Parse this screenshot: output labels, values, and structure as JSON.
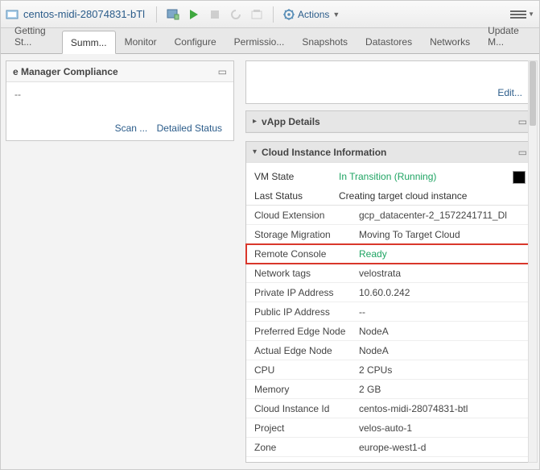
{
  "topbar": {
    "vm_title": "centos-midi-28074831-bTl",
    "actions_label": "Actions"
  },
  "tabs": [
    {
      "label": "Getting St..."
    },
    {
      "label": "Summ..."
    },
    {
      "label": "Monitor"
    },
    {
      "label": "Configure"
    },
    {
      "label": "Permissio..."
    },
    {
      "label": "Snapshots"
    },
    {
      "label": "Datastores"
    },
    {
      "label": "Networks"
    },
    {
      "label": "Update M..."
    }
  ],
  "left_panel": {
    "title": "e Manager Compliance",
    "value": "--",
    "scan_link": "Scan ...",
    "detail_link": "Detailed Status"
  },
  "right_top": {
    "edit_link": "Edit..."
  },
  "vapp_panel": {
    "title": "vApp Details"
  },
  "cloud_panel": {
    "title": "Cloud Instance Information",
    "vm_state_label": "VM State",
    "vm_state_value": "In Transition (Running)",
    "last_status_label": "Last Status",
    "last_status_value": "Creating target cloud instance",
    "rows": [
      {
        "label": "Cloud Extension",
        "value": "gcp_datacenter-2_1572241711_Dl"
      },
      {
        "label": "Storage Migration",
        "value": "Moving To Target Cloud"
      },
      {
        "label": "Remote Console",
        "value": "Ready",
        "green": true,
        "highlight": true
      },
      {
        "label": "Network tags",
        "value": "velostrata"
      },
      {
        "label": "Private IP Address",
        "value": "10.60.0.242"
      },
      {
        "label": "Public IP Address",
        "value": "--"
      },
      {
        "label": "Preferred Edge Node",
        "value": "NodeA"
      },
      {
        "label": "Actual Edge Node",
        "value": "NodeA"
      },
      {
        "label": "CPU",
        "value": "2 CPUs"
      },
      {
        "label": "Memory",
        "value": "2 GB"
      },
      {
        "label": "Cloud Instance Id",
        "value": "centos-midi-28074831-btl"
      },
      {
        "label": "Project",
        "value": "velos-auto-1"
      },
      {
        "label": "Zone",
        "value": "europe-west1-d"
      }
    ]
  }
}
